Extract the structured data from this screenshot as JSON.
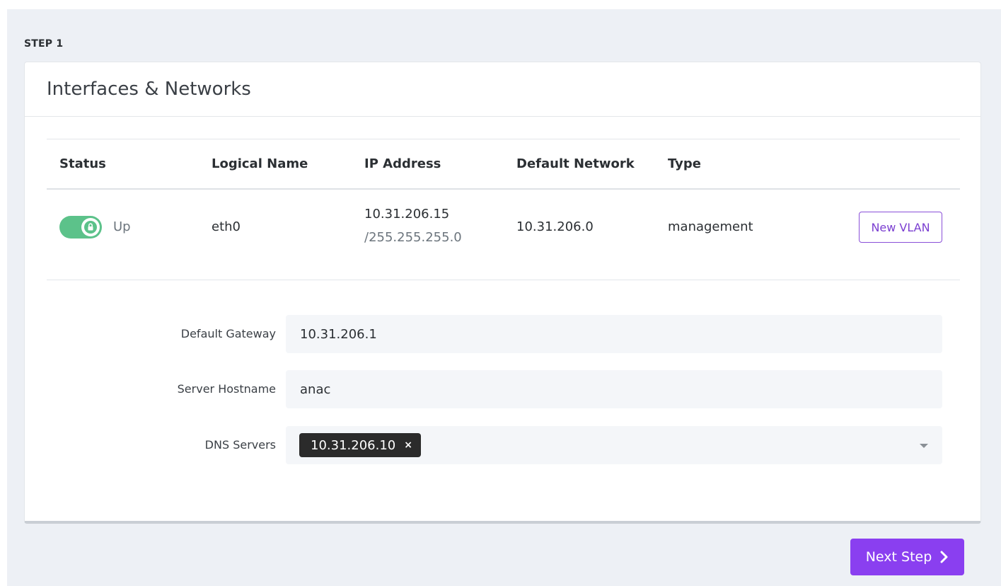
{
  "step": {
    "label": "STEP 1"
  },
  "card": {
    "title": "Interfaces & Networks"
  },
  "table": {
    "headers": {
      "status": "Status",
      "logical_name": "Logical Name",
      "ip_address": "IP Address",
      "default_network": "Default Network",
      "type": "Type"
    },
    "rows": [
      {
        "status": "Up",
        "status_on": true,
        "logical_name": "eth0",
        "ip": "10.31.206.15",
        "mask": "/255.255.255.0",
        "default_network": "10.31.206.0",
        "type": "management",
        "action_label": "New VLAN"
      }
    ]
  },
  "form": {
    "gateway": {
      "label": "Default Gateway",
      "value": "10.31.206.1"
    },
    "hostname": {
      "label": "Server Hostname",
      "value": "anac"
    },
    "dns": {
      "label": "DNS Servers",
      "chips": [
        "10.31.206.10"
      ],
      "remove_symbol": "×"
    }
  },
  "next_button": {
    "label": "Next Step",
    "icon": "chevron-right-icon"
  },
  "colors": {
    "accent": "#8a3ff0",
    "toggle_on": "#5cc28a",
    "background": "#edf0f5"
  }
}
